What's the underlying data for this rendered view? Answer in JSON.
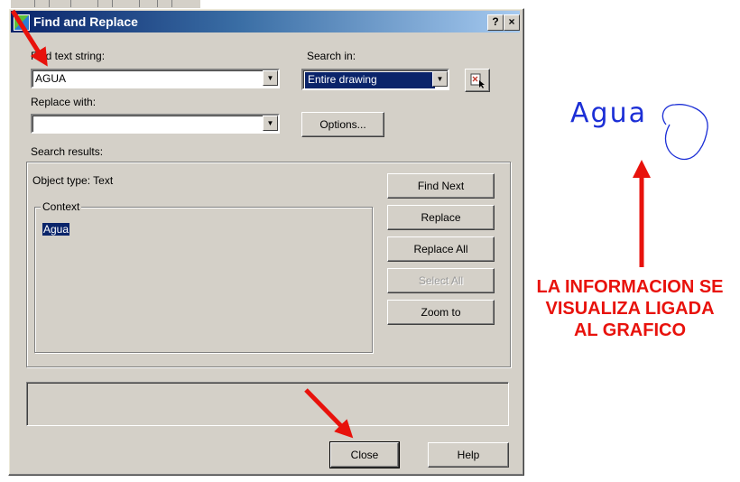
{
  "dialog": {
    "title": "Find and Replace",
    "help_icon": "?",
    "close_icon": "×"
  },
  "find": {
    "label": "Find text string:",
    "value": "AGUA"
  },
  "search_in": {
    "label": "Search in:",
    "selected": "Entire drawing"
  },
  "replace": {
    "label": "Replace with:",
    "value": ""
  },
  "options_label": "Options...",
  "results": {
    "label": "Search results:",
    "object_type": "Object type: Text",
    "context_label": "Context",
    "context_value": "Agua"
  },
  "buttons": {
    "find_next": "Find Next",
    "replace": "Replace",
    "replace_all": "Replace All",
    "select_all": "Select All",
    "zoom_to": "Zoom to",
    "close": "Close",
    "help": "Help"
  },
  "drawing": {
    "text": "Agua"
  },
  "annotation": {
    "line1": "LA INFORMACION SE",
    "line2": "VISUALIZA LIGADA",
    "line3": "AL GRAFICO"
  },
  "colors": {
    "dialog_bg": "#d4d0c8",
    "title_gradient_start": "#0a246a",
    "title_gradient_end": "#a6caf0",
    "selection": "#0a246a",
    "annotation_red": "#e8120c",
    "drawing_blue": "#1c2fd6"
  }
}
